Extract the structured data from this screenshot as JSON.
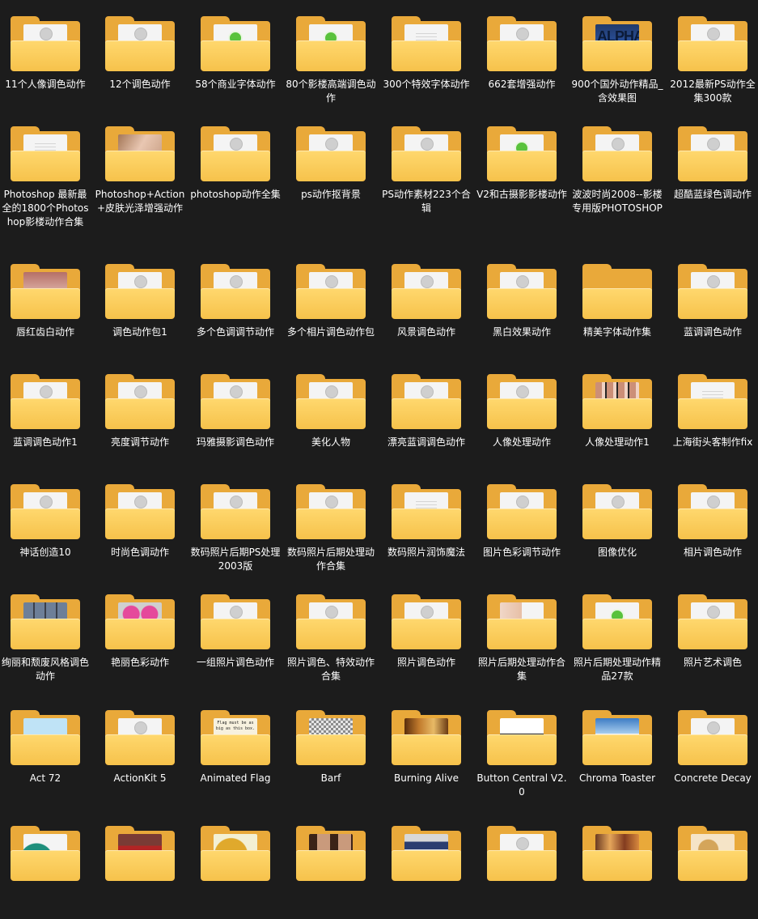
{
  "colors": {
    "background": "#1c1c1c",
    "folder_front": "#f6c24b",
    "folder_back": "#e9a93a",
    "label_text": "#ffffff"
  },
  "folders": [
    {
      "label": "11个人像调色动作",
      "icon": "plugin-icon"
    },
    {
      "label": "12个调色动作",
      "icon": "plugin-icon"
    },
    {
      "label": "58个商业字体动作",
      "icon": "ok-icon"
    },
    {
      "label": "80个影楼高端调色动作",
      "icon": "ok-icon"
    },
    {
      "label": "300个特效字体动作",
      "icon": "document-icon"
    },
    {
      "label": "662套增强动作",
      "icon": "plugin-icon"
    },
    {
      "label": "900个国外动作精品_含效果图",
      "icon": "img-alpha",
      "thumb_text": "ALPHA"
    },
    {
      "label": "2012最新PS动作全集300款",
      "icon": "plugin-icon"
    },
    {
      "label": "Photoshop 最新最全的1800个Photoshop影楼动作合集",
      "icon": "document-icon"
    },
    {
      "label": "Photoshop+Action+皮肤光泽增强动作",
      "icon": "img-photo"
    },
    {
      "label": "photoshop动作全集",
      "icon": "plugin-icon"
    },
    {
      "label": "ps动作抠背景",
      "icon": "plugin-icon"
    },
    {
      "label": "PS动作素材223个合辑",
      "icon": "plugin-icon"
    },
    {
      "label": "V2和古摄影影楼动作",
      "icon": "ok-icon"
    },
    {
      "label": "波波时尚2008--影楼专用版PHOTOSHOP",
      "icon": "plugin-icon"
    },
    {
      "label": "超酷蓝绿色调动作",
      "icon": "plugin-icon"
    },
    {
      "label": "唇红齿白动作",
      "icon": "img-lips"
    },
    {
      "label": "调色动作包1",
      "icon": "plugin-icon"
    },
    {
      "label": "多个色调调节动作",
      "icon": "plugin-icon"
    },
    {
      "label": "多个相片调色动作包",
      "icon": "plugin-icon"
    },
    {
      "label": "风景调色动作",
      "icon": "plugin-icon"
    },
    {
      "label": "黑白效果动作",
      "icon": "plugin-icon"
    },
    {
      "label": "精美字体动作集",
      "icon": "empty"
    },
    {
      "label": "蓝调调色动作",
      "icon": "plugin-icon"
    },
    {
      "label": "蓝调调色动作1",
      "icon": "plugin-icon"
    },
    {
      "label": "亮度调节动作",
      "icon": "plugin-icon"
    },
    {
      "label": "玛雅摄影调色动作",
      "icon": "plugin-icon"
    },
    {
      "label": "美化人物",
      "icon": "plugin-icon"
    },
    {
      "label": "漂亮蓝调调色动作",
      "icon": "plugin-icon"
    },
    {
      "label": "人像处理动作",
      "icon": "plugin-icon"
    },
    {
      "label": "人像处理动作1",
      "icon": "img-faces"
    },
    {
      "label": "上海街头客制作fix",
      "icon": "document-icon"
    },
    {
      "label": "神话创造10",
      "icon": "plugin-icon"
    },
    {
      "label": "时尚色调动作",
      "icon": "plugin-icon"
    },
    {
      "label": "数码照片后期PS处理2003版",
      "icon": "plugin-icon"
    },
    {
      "label": "数码照片后期处理动作合集",
      "icon": "plugin-icon"
    },
    {
      "label": "数码照片润饰魔法",
      "icon": "document-icon"
    },
    {
      "label": "图片色彩调节动作",
      "icon": "plugin-icon"
    },
    {
      "label": "图像优化",
      "icon": "plugin-icon"
    },
    {
      "label": "相片调色动作",
      "icon": "plugin-icon"
    },
    {
      "label": "绚丽和颓废风格调色动作",
      "icon": "img-thumbs"
    },
    {
      "label": "艳丽色彩动作",
      "icon": "img-pink"
    },
    {
      "label": "一组照片调色动作",
      "icon": "plugin-icon"
    },
    {
      "label": "照片调色、特效动作合集",
      "icon": "plugin-icon"
    },
    {
      "label": "照片调色动作",
      "icon": "plugin-icon"
    },
    {
      "label": "照片后期处理动作合集",
      "icon": "img-web"
    },
    {
      "label": "照片后期处理动作精品27款",
      "icon": "ok-icon"
    },
    {
      "label": "照片艺术调色",
      "icon": "plugin-icon"
    },
    {
      "label": "Act 72",
      "icon": "img-blue"
    },
    {
      "label": "ActionKit 5",
      "icon": "plugin-icon"
    },
    {
      "label": "Animated Flag",
      "icon": "img-flag",
      "thumb_text": "Flag must be as big as this box."
    },
    {
      "label": "Barf",
      "icon": "img-check"
    },
    {
      "label": "Burning Alive",
      "icon": "img-burn"
    },
    {
      "label": "Button Central V2.0",
      "icon": "img-ui"
    },
    {
      "label": "Chroma Toaster",
      "icon": "img-sky"
    },
    {
      "label": "Concrete Decay",
      "icon": "plugin-icon"
    },
    {
      "label": "",
      "icon": "img-teal"
    },
    {
      "label": "",
      "icon": "img-car"
    },
    {
      "label": "",
      "icon": "img-action"
    },
    {
      "label": "",
      "icon": "img-women"
    },
    {
      "label": "",
      "icon": "img-panel"
    },
    {
      "label": "",
      "icon": "plugin-icon"
    },
    {
      "label": "",
      "icon": "img-rock"
    },
    {
      "label": "",
      "icon": "img-coins"
    }
  ]
}
